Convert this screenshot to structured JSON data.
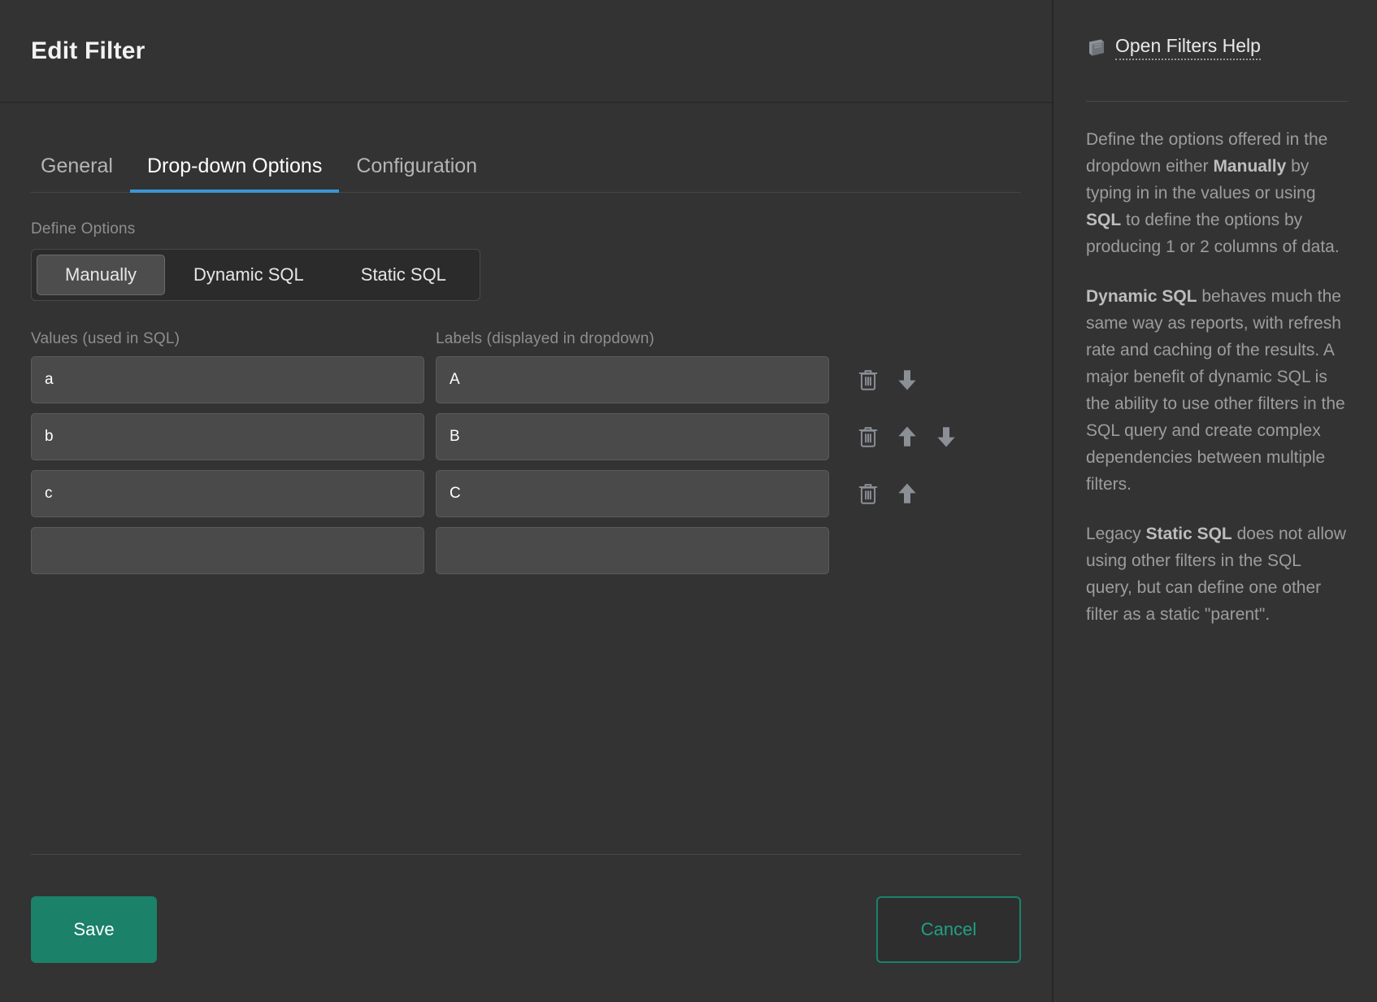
{
  "dialog": {
    "title": "Edit Filter"
  },
  "tabs": [
    {
      "label": "General",
      "active": false
    },
    {
      "label": "Drop-down Options",
      "active": true
    },
    {
      "label": "Configuration",
      "active": false
    }
  ],
  "define_options": {
    "label": "Define Options",
    "segments": [
      {
        "label": "Manually",
        "active": true
      },
      {
        "label": "Dynamic SQL",
        "active": false
      },
      {
        "label": "Static SQL",
        "active": false
      }
    ]
  },
  "options_table": {
    "values_header": "Values (used in SQL)",
    "labels_header": "Labels (displayed in dropdown)",
    "rows": [
      {
        "value": "a",
        "label": "A",
        "actions": [
          "delete-icon",
          "arrow-down-icon"
        ]
      },
      {
        "value": "b",
        "label": "B",
        "actions": [
          "delete-icon",
          "arrow-up-icon",
          "arrow-down-icon"
        ]
      },
      {
        "value": "c",
        "label": "C",
        "actions": [
          "delete-icon",
          "arrow-up-icon"
        ]
      },
      {
        "value": "",
        "label": "",
        "actions": []
      }
    ],
    "value_placeholder": "",
    "label_placeholder": ""
  },
  "footer": {
    "save_label": "Save",
    "cancel_label": "Cancel"
  },
  "help": {
    "link_label": "Open Filters Help",
    "link_icon": "book-icon",
    "paragraph_1_part_1": "Define the options offered in the dropdown either ",
    "paragraph_1_bold_1": "Manually",
    "paragraph_1_part_2": " by typing in in the values or using ",
    "paragraph_1_bold_2": "SQL",
    "paragraph_1_part_3": " to define the options by producing 1 or 2 columns of data.",
    "paragraph_2_bold_1": "Dynamic SQL",
    "paragraph_2_part_1": " behaves much the same way as reports, with refresh rate and caching of the results. A major benefit of dynamic SQL is the ability to use other filters in the SQL query and create complex dependencies between multiple filters.",
    "paragraph_3_part_1": "Legacy ",
    "paragraph_3_bold_1": "Static SQL",
    "paragraph_3_part_2": " does not allow using other filters in the SQL query, but can define one other filter as a static \"parent\"."
  },
  "colors": {
    "accent_tab": "#3b96d4",
    "save_bg": "#1b8169",
    "cancel_border": "#1b8169",
    "cancel_text": "#1ea184",
    "panel_bg": "#333333",
    "input_bg": "#4a4a4a"
  }
}
